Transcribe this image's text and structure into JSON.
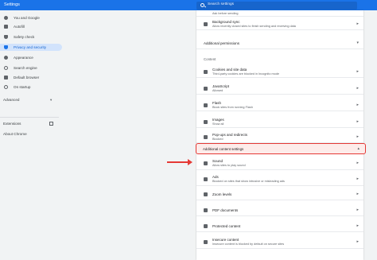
{
  "header": {
    "title": "Settings",
    "search_placeholder": "Search settings"
  },
  "sidebar": {
    "items": [
      {
        "label": "You and Google",
        "icon": "person-icon"
      },
      {
        "label": "Autofill",
        "icon": "autofill-icon"
      },
      {
        "label": "Safety check",
        "icon": "shield-check-icon"
      },
      {
        "label": "Privacy and security",
        "icon": "shield-icon"
      },
      {
        "label": "Appearance",
        "icon": "palette-icon"
      },
      {
        "label": "Search engine",
        "icon": "search-icon"
      },
      {
        "label": "Default browser",
        "icon": "browser-icon"
      },
      {
        "label": "On startup",
        "icon": "power-icon"
      }
    ],
    "advanced": "Advanced",
    "extensions": "Extensions",
    "about": "About Chrome"
  },
  "content": {
    "top_partial_sub": "Ask before sending",
    "background_sync": {
      "title": "Background sync",
      "sub": "Allow recently closed sites to finish sending and receiving data"
    },
    "additional_permissions": "Additional permissions",
    "content_label": "Content",
    "rows": [
      {
        "title": "Cookies and site data",
        "sub": "Third-party cookies are blocked in Incognito mode",
        "icon": "cookie-icon"
      },
      {
        "title": "JavaScript",
        "sub": "Allowed",
        "icon": "code-icon"
      },
      {
        "title": "Flash",
        "sub": "Block sites from running Flash",
        "icon": "puzzle-icon"
      },
      {
        "title": "Images",
        "sub": "Show all",
        "icon": "image-icon"
      },
      {
        "title": "Pop-ups and redirects",
        "sub": "Blocked",
        "icon": "popup-icon"
      }
    ],
    "additional_content_settings": "Additional content settings",
    "expanded_rows": [
      {
        "title": "Sound",
        "sub": "Allow sites to play sound",
        "icon": "speaker-icon"
      },
      {
        "title": "Ads",
        "sub": "Blocked on sites that show intrusive or misleading ads",
        "icon": "ads-icon"
      },
      {
        "title": "Zoom levels",
        "sub": "",
        "icon": "zoom-icon"
      },
      {
        "title": "PDF documents",
        "sub": "",
        "icon": "pdf-icon"
      },
      {
        "title": "Protected content",
        "sub": "",
        "icon": "protected-content-icon"
      },
      {
        "title": "Insecure content",
        "sub": "Insecure content is blocked by default on secure sites",
        "icon": "warning-icon"
      }
    ]
  },
  "colors": {
    "accent": "#1a73e8",
    "highlight": "#e53935"
  }
}
